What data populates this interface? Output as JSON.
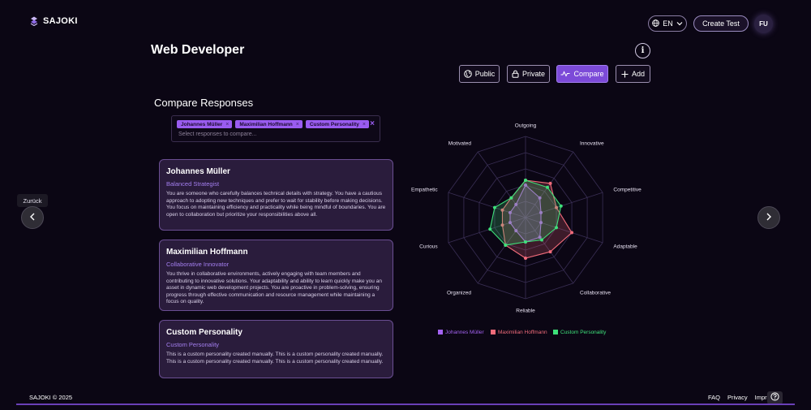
{
  "brand": {
    "name": "SAJOKI"
  },
  "header": {
    "language": "EN",
    "create_label": "Create Test",
    "avatar_initials": "FU"
  },
  "page": {
    "title": "Web Developer"
  },
  "toolbar": {
    "public_label": "Public",
    "private_label": "Private",
    "compare_label": "Compare",
    "add_label": "Add"
  },
  "compare": {
    "title": "Compare Responses",
    "chips": [
      "Johannes Müller",
      "Maximilian Hoffmann",
      "Custom Personality"
    ],
    "placeholder": "Select responses to compare..."
  },
  "cards": [
    {
      "name": "Johannes Müller",
      "type": "Balanced Strategist",
      "description": "You are someone who carefully balances technical details with strategy. You have a cautious approach to adopting new techniques and prefer to wait for stability before making decisions. You focus on maintaining efficiency and practicality while being mindful of boundaries. You are open to collaboration but prioritize your responsibilities above all."
    },
    {
      "name": "Maximilian Hoffmann",
      "type": "Collaborative Innovator",
      "description": "You thrive in collaborative environments, actively engaging with team members and contributing to innovative solutions. Your adaptability and ability to learn quickly make you an asset in dynamic web development projects. You are proactive in problem-solving, ensuring progress through effective communication and resource management while maintaining a focus on quality."
    },
    {
      "name": "Custom Personality",
      "type": "Custom Personality",
      "description": "This is a custom personality created manually. This is a custom personality created manually. This is a custom personality created manually. This is a custom personality created manually."
    }
  ],
  "nav": {
    "prev_tooltip": "Zurück"
  },
  "chart_data": {
    "type": "radar",
    "axes": [
      "Outgoing",
      "Innovative",
      "Competitive",
      "Adaptable",
      "Collaborative",
      "Reliable",
      "Organized",
      "Curious",
      "Empathetic",
      "Motivated"
    ],
    "levels": 5,
    "max": 5,
    "series": [
      {
        "name": "Johannes Müller",
        "color": "#a463f2",
        "values": [
          2,
          1.5,
          1,
          1,
          1.5,
          1.5,
          1,
          1,
          1,
          1
        ]
      },
      {
        "name": "Maximilian Hoffmann",
        "color": "#f06b7a",
        "values": [
          2.3,
          2.6,
          2,
          3,
          2.6,
          2.5,
          2.1,
          1.5,
          1.5,
          1.5
        ]
      },
      {
        "name": "Custom Personality",
        "color": "#3ee07a",
        "values": [
          2.3,
          2.3,
          2.3,
          2,
          1.7,
          1.5,
          2.1,
          2.3,
          2,
          1.5
        ]
      }
    ]
  },
  "footer": {
    "copyright": "SAJOKI © 2025",
    "links": [
      "FAQ",
      "Privacy",
      "Impri"
    ]
  },
  "colors": {
    "background": "#0b0614",
    "accent": "#7c4ad8",
    "card_bg": "#2a1c3c",
    "card_border": "#6a4e92"
  }
}
